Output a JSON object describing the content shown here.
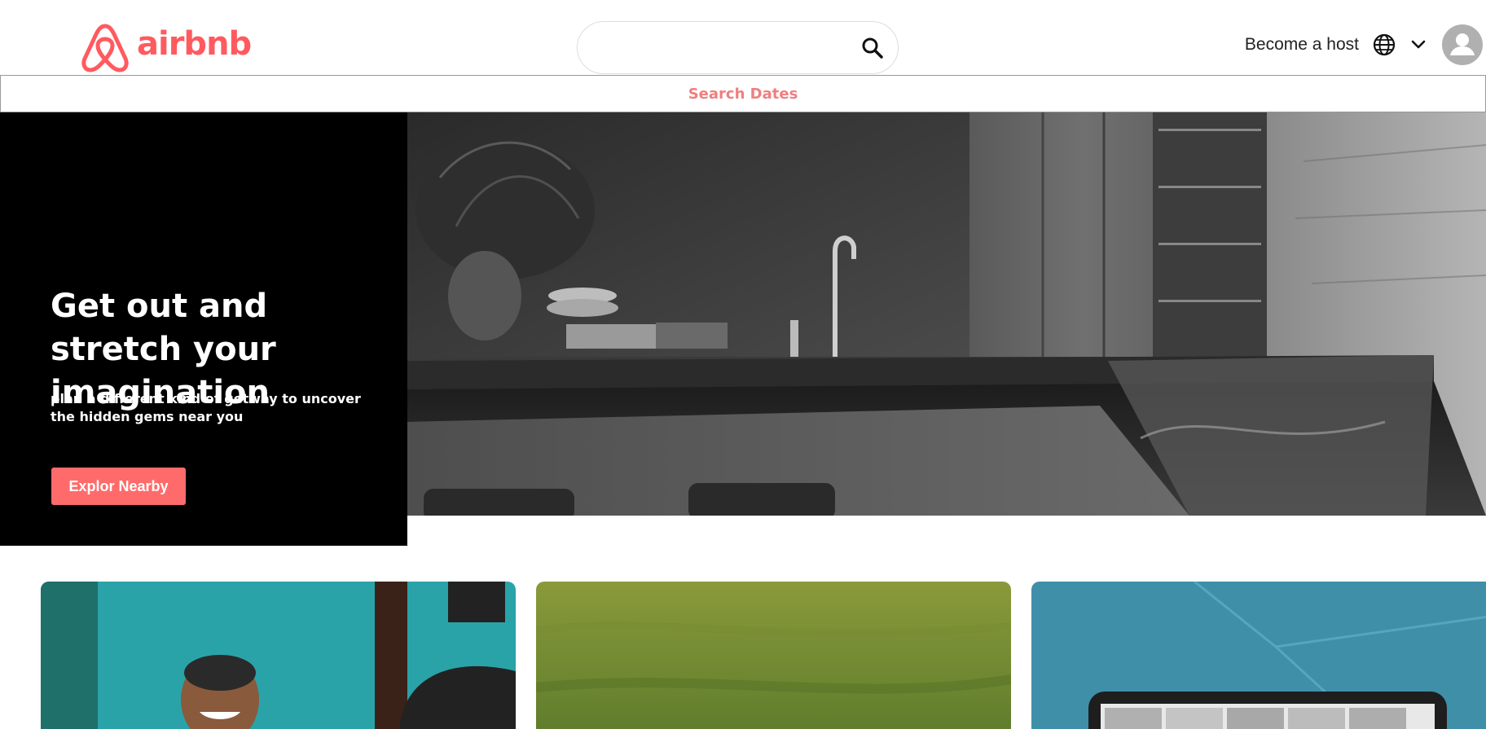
{
  "header": {
    "logo_text": "airbnb",
    "search": {
      "value": "",
      "placeholder": ""
    },
    "become_host_label": "Become a host",
    "icons": [
      "airbnb-logo-icon",
      "search-icon",
      "globe-icon",
      "chevron-down-icon",
      "user-avatar-icon"
    ]
  },
  "dates_bar": {
    "label": "Search Dates"
  },
  "hero": {
    "title": "Get out and stretch your imagination",
    "subtitle": "plan a different kind of getway to uncover the hidden gems near you",
    "button_label": "Explor Nearby"
  },
  "colors": {
    "brand": "#ff5a5f",
    "dates_text": "#ef7f7f",
    "hero_button": "#ff6b6b",
    "hero_panel": "#000000"
  }
}
